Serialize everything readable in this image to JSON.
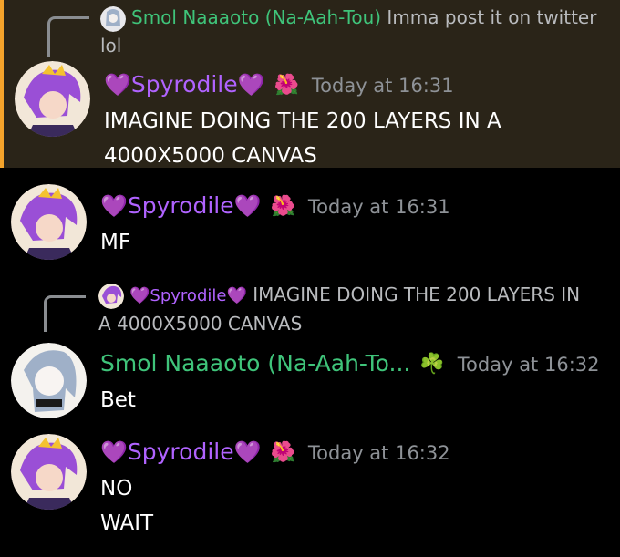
{
  "messages": [
    {
      "reply": {
        "author": "Smol Naaaoto (Na-Aah-Tou)",
        "text_line1": "Imma post it on twitter",
        "text_line2": "lol"
      },
      "author": "Spyrodile",
      "heart_left": "💜",
      "heart_right": "💜",
      "badge": "🌺",
      "time": "Today at 16:31",
      "lines": [
        "IMAGINE DOING THE 200 LAYERS IN A",
        "4000X5000 CANVAS"
      ]
    },
    {
      "author": "Spyrodile",
      "heart_left": "💜",
      "heart_right": "💜",
      "badge": "🌺",
      "time": "Today at 16:31",
      "lines": [
        "MF"
      ]
    },
    {
      "reply": {
        "author": "Spyrodile",
        "heart_left": "💜",
        "heart_right": "💜",
        "text_line1": "IMAGINE DOING THE 200 LAYERS IN",
        "text_line2": "A 4000X5000 CANVAS"
      },
      "author": "Smol Naaaoto (Na-Aah-To...",
      "badge": "☘️",
      "time": "Today at 16:32",
      "lines": [
        "Bet"
      ]
    },
    {
      "author": "Spyrodile",
      "heart_left": "💜",
      "heart_right": "💜",
      "badge": "🌺",
      "time": "Today at 16:32",
      "lines": [
        "NO",
        "WAIT"
      ]
    }
  ],
  "colors": {
    "background": "#000000",
    "highlight_bg": "#2a2418",
    "highlight_border": "#f4a32b",
    "green_name": "#3fc47a",
    "purple_name": "#b063ff",
    "timestamp": "#8e9297"
  }
}
